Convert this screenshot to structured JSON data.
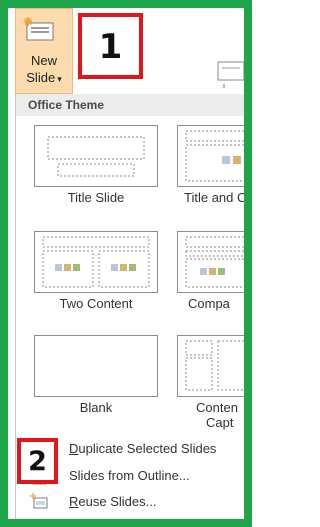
{
  "ribbon": {
    "new_slide_line1": "New",
    "new_slide_line2": "Slide",
    "new_slide_caret": "▾"
  },
  "gallery": {
    "theme_header": "Office Theme",
    "layouts": [
      {
        "label": "Title Slide"
      },
      {
        "label": "Title and C"
      },
      {
        "label": "Two Content"
      },
      {
        "label": "Compa"
      },
      {
        "label": "Blank"
      },
      {
        "label_line1": "Conten",
        "label_line2": "Capt"
      }
    ]
  },
  "commands": [
    {
      "label": "Duplicate Selected Slides",
      "underline": "D",
      "rest": "uplicate Selected Slides"
    },
    {
      "label": "Slides from Outline...",
      "underline": "",
      "rest": "Slides from Outline..."
    },
    {
      "label": "Reuse Slides...",
      "underline": "R",
      "rest": "euse Slides..."
    }
  ],
  "annotations": {
    "callout_1": "1",
    "callout_2": "2"
  },
  "colors": {
    "frame": "#1fa64a",
    "callout_border": "#e0161b",
    "new_slide_bg": "#fcdcae"
  }
}
